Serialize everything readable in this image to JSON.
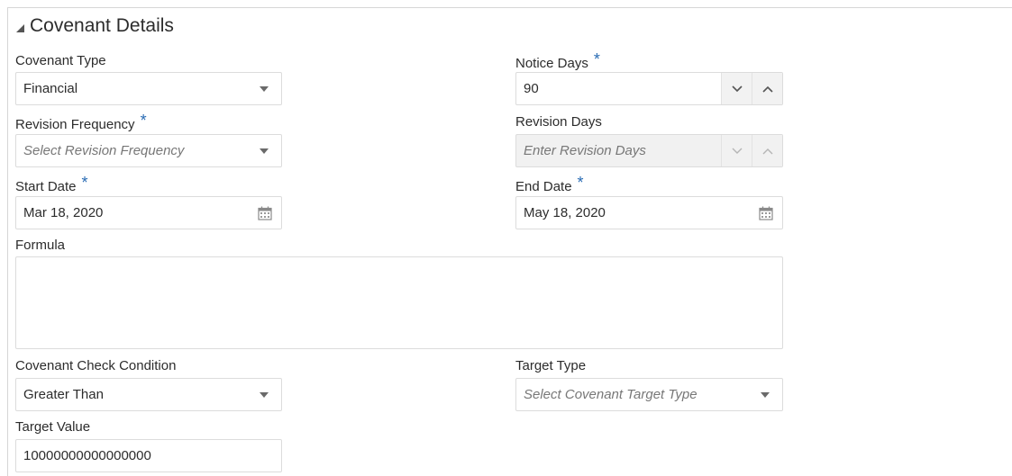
{
  "section": {
    "title": "Covenant Details"
  },
  "covenant_type": {
    "label": "Covenant Type",
    "value": "Financial"
  },
  "notice_days": {
    "label": "Notice Days",
    "required": "*",
    "value": "90"
  },
  "revision_frequency": {
    "label": "Revision Frequency",
    "required": "*",
    "placeholder": "Select Revision Frequency"
  },
  "revision_days": {
    "label": "Revision Days",
    "placeholder": "Enter Revision Days"
  },
  "start_date": {
    "label": "Start Date",
    "required": "*",
    "value": "Mar 18, 2020"
  },
  "end_date": {
    "label": "End Date",
    "required": "*",
    "value": "May 18, 2020"
  },
  "formula": {
    "label": "Formula",
    "value": ""
  },
  "check_condition": {
    "label": "Covenant Check Condition",
    "value": "Greater Than"
  },
  "target_type": {
    "label": "Target Type",
    "placeholder": "Select Covenant Target Type"
  },
  "target_value": {
    "label": "Target Value",
    "value": "10000000000000000"
  },
  "colors": {
    "required": "#2a6cb4",
    "border": "#dcdcdc",
    "disabled_bg": "#f1f1f1"
  },
  "icons": [
    "collapse-caret-icon",
    "dropdown-arrow-icon",
    "chevron-down-icon",
    "chevron-up-icon",
    "calendar-icon"
  ]
}
